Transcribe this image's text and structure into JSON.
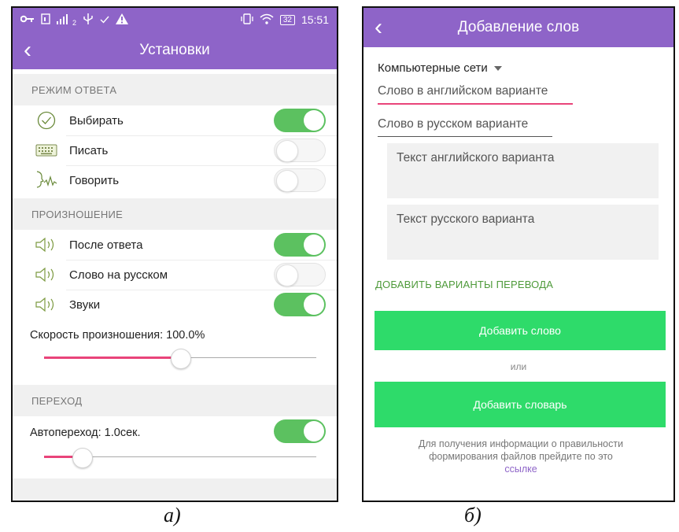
{
  "left": {
    "status": {
      "time": "15:51",
      "battery": "32",
      "carrier_sub": "2"
    },
    "title": "Установки",
    "sections": {
      "answer": {
        "header": "РЕЖИМ ОТВЕТА",
        "items": [
          {
            "label": "Выбирать",
            "icon": "check-circle-icon",
            "on": true
          },
          {
            "label": "Писать",
            "icon": "keyboard-icon",
            "on": false
          },
          {
            "label": "Говорить",
            "icon": "speaking-head-icon",
            "on": false
          }
        ]
      },
      "pronunciation": {
        "header": "ПРОИЗНОШЕНИЕ",
        "items": [
          {
            "label": "После ответа",
            "icon": "speaker-icon",
            "on": true
          },
          {
            "label": "Слово на русском",
            "icon": "speaker-icon",
            "on": false
          },
          {
            "label": "Звуки",
            "icon": "speaker-icon",
            "on": true
          }
        ],
        "speed_label": "Скорость произношения: 100.0%",
        "speed_fraction": 0.5
      },
      "transition": {
        "header": "ПЕРЕХОД",
        "auto_label": "Автопереход: 1.0сек.",
        "auto_on": true,
        "auto_fraction": 0.14
      }
    },
    "caption": "а)"
  },
  "right": {
    "title": "Добавление слов",
    "dropdown": "Компьютерные сети",
    "english_placeholder": "Слово в английском варианте",
    "russian_placeholder": "Слово в русском варианте",
    "english_text_placeholder": "Текст английского варианта",
    "russian_text_placeholder": "Текст русского варианта",
    "add_variants": "ДОБАВИТЬ ВАРИАНТЫ ПЕРЕВОДА",
    "add_word": "Добавить слово",
    "or": "или",
    "add_dictionary": "Добавить словарь",
    "info_line1": "Для получения информации о правильности",
    "info_line2": "формирования файлов прейдите по это",
    "info_link": "ссылке",
    "caption": "б)"
  },
  "colors": {
    "appbar": "#8e64c8",
    "toggle_on": "#5cc160",
    "accent_pink": "#e9447a",
    "button_green": "#2edb6a",
    "link_green": "#4e9a3a"
  }
}
